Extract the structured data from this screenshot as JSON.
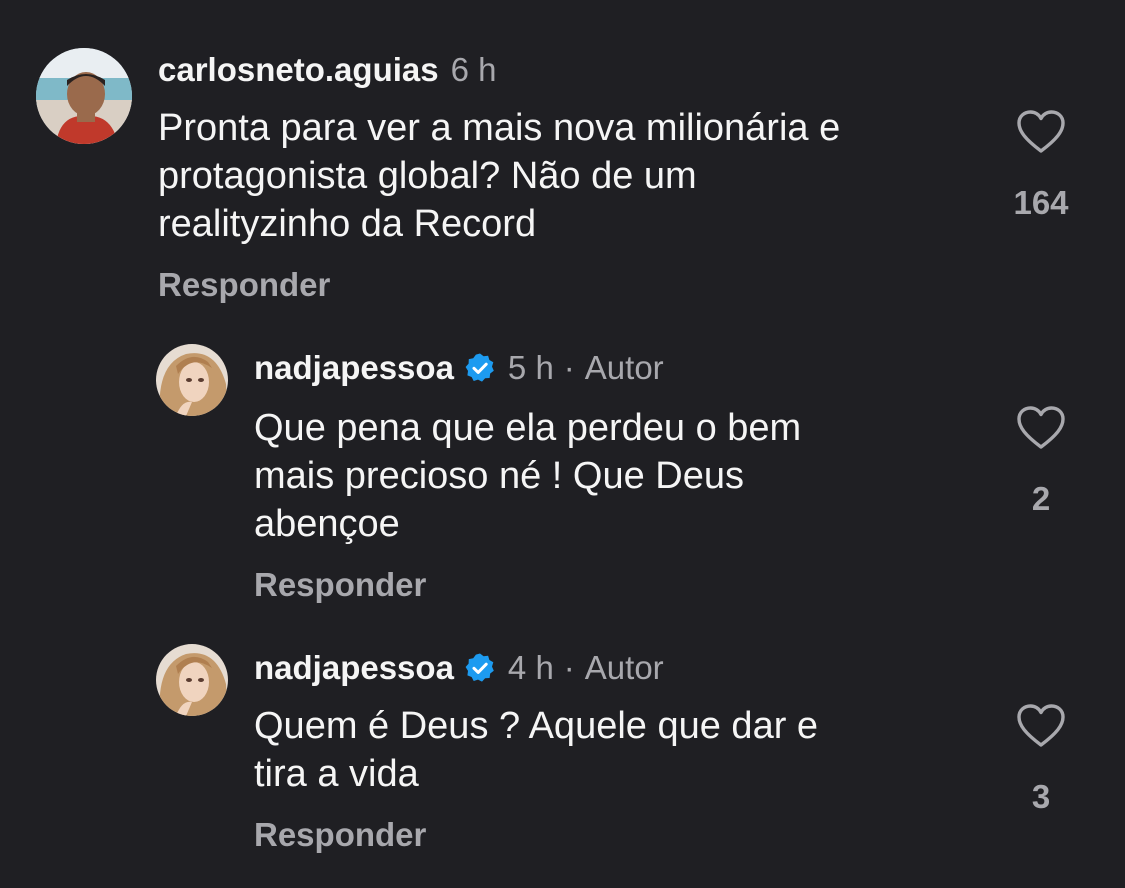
{
  "comments": [
    {
      "username": "carlosneto.aguias",
      "time": "6 h",
      "lines": [
        "Pronta para ver a mais nova milionária e",
        "protagonista global? Não de um",
        "realityzinho da Record"
      ],
      "reply_label": "Responder",
      "likes": "164"
    },
    {
      "username": "nadjapessoa",
      "verified": true,
      "time": "5 h",
      "separator": "·",
      "author_label": "Autor",
      "lines": [
        "Que pena que ela perdeu o bem",
        "mais precioso né ! Que Deus",
        "abençoe"
      ],
      "reply_label": "Responder",
      "likes": "2"
    },
    {
      "username": "nadjapessoa",
      "verified": true,
      "time": "4 h",
      "separator": "·",
      "author_label": "Autor",
      "lines": [
        "Quem é Deus ? Aquele que dar e",
        "tira a vida"
      ],
      "reply_label": "Responder",
      "likes": "3"
    }
  ],
  "colors": {
    "background": "#1f1f23",
    "primary_text": "#f5f5f5",
    "secondary_text": "#a8a8ad",
    "verified_badge": "#1d9bf0"
  },
  "icons": {
    "like": "heart-outline-icon",
    "verified": "verified-badge-icon"
  }
}
